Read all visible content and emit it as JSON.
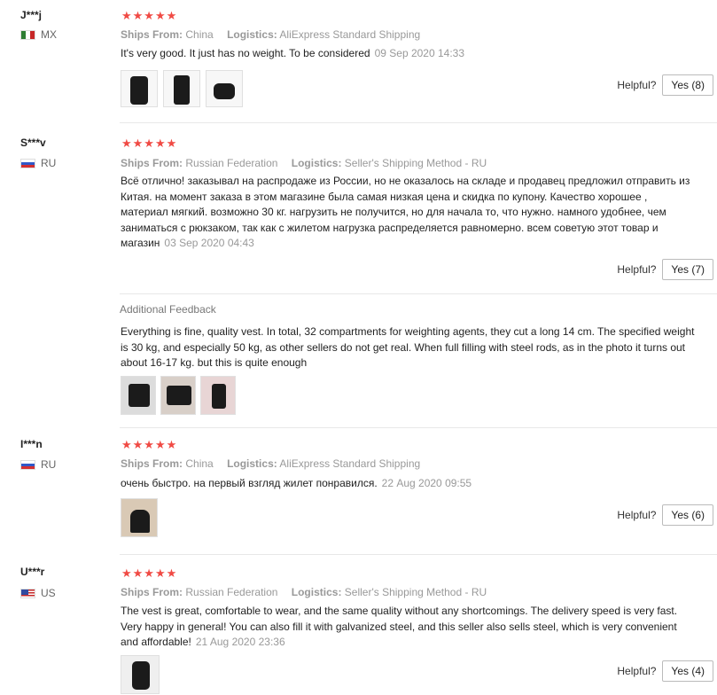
{
  "labels": {
    "ships_from": "Ships From:",
    "logistics": "Logistics:",
    "helpful": "Helpful?",
    "additional_feedback": "Additional Feedback"
  },
  "colors": {
    "star": "#f04a44",
    "meta": "#999999"
  },
  "reviews": [
    {
      "user": "J***j",
      "country": "MX",
      "flag_icon": "mexico-flag-icon",
      "stars": "★★★★★",
      "ships_from": "China",
      "logistics": "AliExpress Standard Shipping",
      "text": "It's very good. It just has no weight. To be considered",
      "date": "09 Sep 2020 14:33",
      "helpful_button": "Yes (8)"
    },
    {
      "user": "S***v",
      "country": "RU",
      "flag_icon": "russia-flag-icon",
      "stars": "★★★★★",
      "ships_from": "Russian Federation",
      "logistics": "Seller's Shipping Method - RU",
      "text": "Всё отлично! заказывал на распродаже из России, но не оказалось на складе и продавец предложил отправить из Китая. на момент заказа в этом магазине была самая низкая цена и скидка по купону. Качество хорошее , материал мягкий. возможно 30 кг. нагрузить не получится, но для начала то, что нужно. намного удобнее, чем заниматься с рюкзаком, так как с жилетом нагрузка распределяется равномерно. всем советую этот товар и магазин",
      "date": "03 Sep 2020 04:43",
      "helpful_button": "Yes (7)",
      "additional_text": "Everything is fine, quality vest. In total, 32 compartments for weighting agents, they cut a long 14 cm. The specified weight is 30 kg, and especially 50 kg, as other sellers do not get real. When full filling with steel rods, as in the photo it turns out about 16-17 kg. but this is quite enough"
    },
    {
      "user": "I***n",
      "country": "RU",
      "flag_icon": "russia-flag-icon",
      "stars": "★★★★★",
      "ships_from": "China",
      "logistics": "AliExpress Standard Shipping",
      "text": "очень быстро. на первый взгляд жилет понравился.",
      "date": "22 Aug 2020 09:55",
      "helpful_button": "Yes (6)"
    },
    {
      "user": "U***r",
      "country": "US",
      "flag_icon": "usa-flag-icon",
      "stars": "★★★★★",
      "ships_from": "Russian Federation",
      "logistics": "Seller's Shipping Method - RU",
      "text": "The vest is great, comfortable to wear, and the same quality without any shortcomings. The delivery speed is very fast. Very happy in general! You can also fill it with galvanized steel, and this seller also sells steel, which is very convenient and affordable!",
      "date": "21 Aug 2020 23:36",
      "helpful_button": "Yes (4)"
    }
  ]
}
